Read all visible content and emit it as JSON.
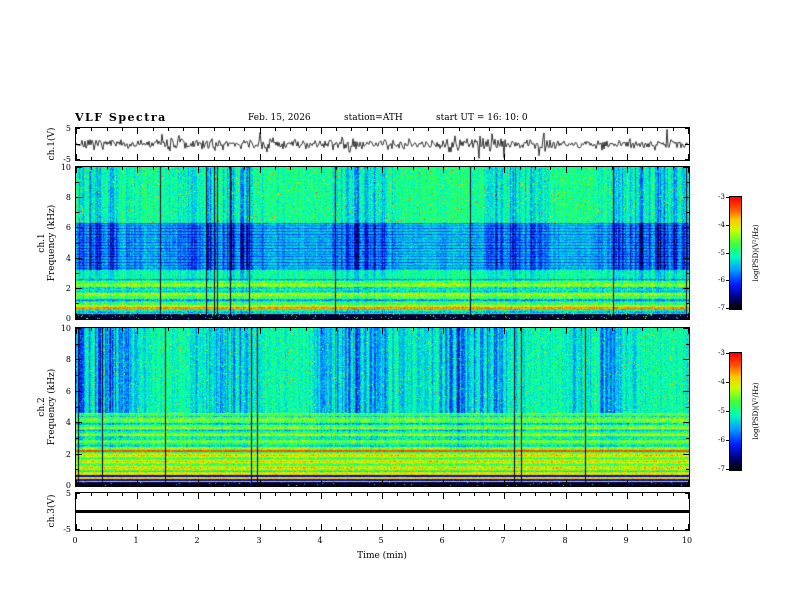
{
  "title": "VLF  Spectra",
  "header": {
    "date": "Feb. 15, 2026",
    "station": "station=ATH",
    "start_ut": "start UT  =   16: 10: 0"
  },
  "x_axis": {
    "label": "Time (min)",
    "range": [
      0,
      10
    ],
    "major_ticks": [
      0,
      1,
      2,
      3,
      4,
      5,
      6,
      7,
      8,
      9,
      10
    ],
    "minor_step": 0.25
  },
  "panels": {
    "ch1_wave": {
      "ylabel": "ch.1(V)",
      "yrange": [
        -5,
        5
      ],
      "yticks": [
        5,
        -5
      ]
    },
    "ch1_spec": {
      "ylabel_lines": [
        "ch.1",
        "Frequency (kHz)"
      ],
      "yrange": [
        0,
        10
      ],
      "yticks": [
        0,
        2,
        4,
        6,
        8,
        10
      ]
    },
    "ch2_spec": {
      "ylabel_lines": [
        "ch.2",
        "Frequency (kHz)"
      ],
      "yrange": [
        0,
        10
      ],
      "yticks": [
        0,
        2,
        4,
        6,
        8,
        10
      ]
    },
    "ch3_wave": {
      "ylabel": "ch.3(V)",
      "yrange": [
        -5,
        5
      ],
      "yticks": [
        5,
        -5
      ]
    }
  },
  "colorbar": {
    "label": "log(PSD)(V²/Hz)",
    "ticks": [
      -3,
      -4,
      -5,
      -6,
      -7
    ],
    "range": [
      -7,
      -3
    ]
  },
  "colors": {
    "background": "#ffffff",
    "frame": "#000000",
    "trace": "#000000",
    "colormap_stops": [
      [
        0.0,
        "#000000"
      ],
      [
        0.1,
        "#000082"
      ],
      [
        0.22,
        "#001eff"
      ],
      [
        0.35,
        "#00a0ff"
      ],
      [
        0.47,
        "#00ffbe"
      ],
      [
        0.58,
        "#3cff3c"
      ],
      [
        0.7,
        "#c8ff00"
      ],
      [
        0.8,
        "#ffc800"
      ],
      [
        0.9,
        "#ff5000"
      ],
      [
        1.0,
        "#ff0000"
      ]
    ]
  },
  "chart_data": [
    {
      "type": "line",
      "panel": "ch.1(V) time series",
      "xlabel": "Time (min)",
      "x_range": [
        0,
        10
      ],
      "ylabel": "ch.1(V)",
      "y_range": [
        -5,
        5
      ],
      "series": [
        {
          "name": "ch.1 broadband voltage",
          "description": "continuous noisy trace centered on 0 V, typical excursions within about ±1–2 V, with sporadic impulsive spikes reaching roughly ±4 V across the full 0–10 min record"
        }
      ]
    },
    {
      "type": "heatmap",
      "panel": "ch.1 spectrogram",
      "xlabel": "Time (min)",
      "ylabel": "Frequency (kHz)",
      "x_range": [
        0,
        10
      ],
      "y_range": [
        0,
        10
      ],
      "z_label": "log(PSD)(V²/Hz)",
      "z_range": [
        -7,
        -3
      ],
      "description": "greenish background near -5; dense vertical blue sferic streaks, strongest between about 3.5 and 6 kHz where the band is darker blue with horizontal dark striations; bright yellow/orange horizontal banding below ~2.5 kHz including an orange line near 0.7 kHz; nearly black band below ~0.4 kHz; numerous narrow black vertical dropout lines spread over the whole record"
    },
    {
      "type": "heatmap",
      "panel": "ch.2 spectrogram",
      "xlabel": "Time (min)",
      "ylabel": "Frequency (kHz)",
      "x_range": [
        0,
        10
      ],
      "y_range": [
        0,
        10
      ],
      "z_label": "log(PSD)(V²/Hz)",
      "z_range": [
        -7,
        -3
      ],
      "description": "green background with many blue vertical sferic streaks above ~4.5 kHz; strong yellow/green horizontal banding from ~0.8 to 4.5 kHz with orange/red lines near 4.3, 2.2 and 0.9 kHz; alternating black/orange structure below ~0.8 kHz and a black band below ~0.3 kHz; scattered black vertical dropout lines"
    },
    {
      "type": "line",
      "panel": "ch.3(V) time series",
      "xlabel": "Time (min)",
      "x_range": [
        0,
        10
      ],
      "ylabel": "ch.3(V)",
      "y_range": [
        -5,
        5
      ],
      "series": [
        {
          "name": "ch.3 voltage",
          "description": "perfectly flat thick line at 0 V for the entire 0–10 min record (channel inactive)"
        }
      ]
    }
  ]
}
